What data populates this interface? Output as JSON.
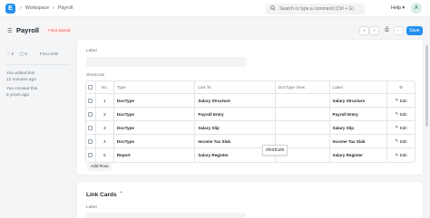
{
  "navbar": {
    "logo": "E",
    "breadcrumbs": [
      "Workspace",
      "Payroll"
    ],
    "search_placeholder": "Search or type a command (Ctrl + G)",
    "help": "Help",
    "avatar": "A"
  },
  "page": {
    "title": "Payroll",
    "status": "Not Saved",
    "save_label": "Save"
  },
  "sidebar": {
    "likes": "0",
    "comments": "0",
    "follow": "FOLLOW",
    "activity": [
      "You edited this",
      "12 minutes ago",
      "You created this",
      "5 years ago"
    ]
  },
  "section": {
    "label_caption": "Label",
    "shortcuts_caption": "Shortcuts",
    "columns": [
      "No.",
      "Type",
      "Link To",
      "DocType View",
      "Label"
    ],
    "rows": [
      {
        "no": "1",
        "type": "DocType",
        "link_to": "Salary Structure",
        "view": "",
        "label": "Salary Structure",
        "edit": "Edit"
      },
      {
        "no": "2",
        "type": "DocType",
        "link_to": "Payroll Entry",
        "view": "",
        "label": "Payroll Entry",
        "edit": "Edit"
      },
      {
        "no": "3",
        "type": "DocType",
        "link_to": "Salary Slip",
        "view": "",
        "label": "Salary Slip",
        "edit": "Edit"
      },
      {
        "no": "4",
        "type": "DocType",
        "link_to": "Income Tax Slab",
        "view": "",
        "label": "Income Tax Slab",
        "edit": "Edit"
      },
      {
        "no": "5",
        "type": "Report",
        "link_to": "Salary Register",
        "view": "",
        "label": "Salary Register",
        "edit": "Edit"
      }
    ],
    "add_row": "Add Row",
    "tooltip": "shortcuts"
  },
  "link_cards": {
    "title": "Link Cards",
    "label_caption": "Label"
  }
}
